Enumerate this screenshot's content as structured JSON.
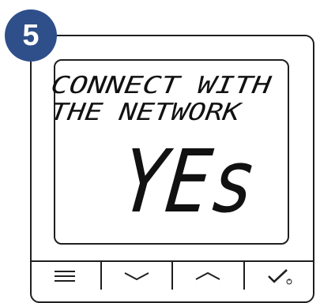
{
  "step": {
    "number": "5"
  },
  "display": {
    "line1": "CONNECT WITH",
    "line2": "THE NETWORK",
    "value": "YEs"
  },
  "buttons": [
    {
      "icon": "menu-icon"
    },
    {
      "icon": "chevron-down-icon"
    },
    {
      "icon": "chevron-up-icon"
    },
    {
      "icon": "checkmark-power-icon"
    }
  ]
}
